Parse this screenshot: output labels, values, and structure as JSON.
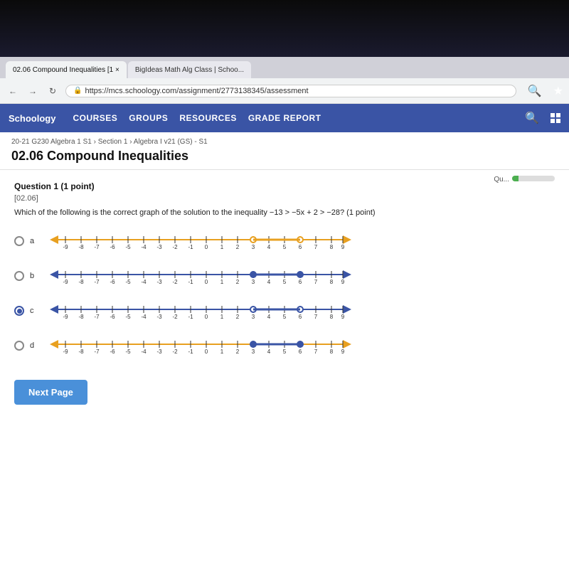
{
  "bezel": {},
  "browser": {
    "tabs": [
      {
        "label": "02.06 Compound Inequalities [1 ×",
        "active": true
      },
      {
        "label": "BigIdeas Math Alg Class | Schoo...",
        "active": false
      }
    ],
    "address": "https://mcs.schoology.com/assignment/2773138345/assessment",
    "nav_items": [
      "COURSES",
      "GROUPS",
      "RESOURCES",
      "GRADE REPORT"
    ]
  },
  "page": {
    "breadcrumb": "20-21 G230 Algebra 1 S1 › Section 1 › Algebra I v21 (GS) - S1",
    "title": "02.06 Compound Inequalities",
    "progress_label": "Qu...",
    "question": {
      "header": "Question 1 (1 point)",
      "tag": "[02.06]",
      "text": "Which of the following is the correct graph of the solution to the inequality −13 > −5x + 2 > −28? (1 point)",
      "options": [
        {
          "id": "a",
          "label": "a",
          "selected": false
        },
        {
          "id": "b",
          "label": "b",
          "selected": false
        },
        {
          "id": "c",
          "label": "c",
          "selected": true
        },
        {
          "id": "d",
          "label": "d",
          "selected": false
        }
      ]
    },
    "next_page_label": "Next Page"
  }
}
